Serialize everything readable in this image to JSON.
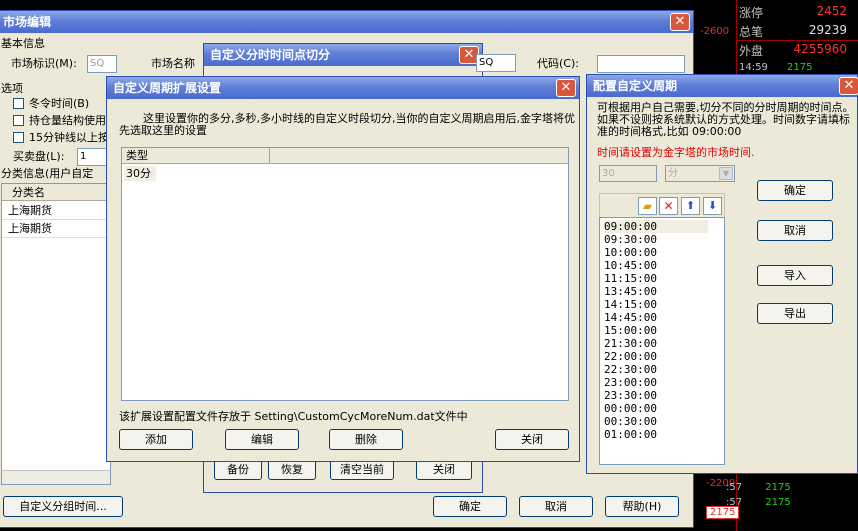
{
  "right_panel": {
    "red_value": "-2600",
    "rows": [
      {
        "label": "涨停",
        "value": "2452"
      },
      {
        "label": "总笔",
        "value": "29239"
      },
      {
        "label": "外盘",
        "value": "4255960"
      }
    ],
    "tick": {
      "time": "14:59",
      "price": "2175"
    },
    "bottom": {
      "red_value": "-2200",
      "rows": [
        {
          "time": ":57",
          "price": "2175"
        },
        {
          "time": ":57",
          "price": "2175"
        }
      ],
      "arrow_price": "2175"
    }
  },
  "market_edit": {
    "title": "市场编辑",
    "basic_info": "基本信息",
    "market_id_label": "市场标识(M):",
    "market_id_value": "SQ",
    "market_name_label": "市场名称",
    "code_label": "代码(C):",
    "options_label": "选项",
    "options": [
      {
        "label": "冬令时间(B)"
      },
      {
        "label": "持仓量结构使用"
      },
      {
        "label": "15分钟线以上按"
      }
    ],
    "buy_sell_label": "买卖盘(L):",
    "buy_sell_value": "1",
    "category_info": "分类信息(用户自定",
    "table_header": "分类名",
    "table_rows": [
      "上海期货",
      "上海期货"
    ],
    "custom_group_button": "自定义分组时间...",
    "ok": "确定",
    "cancel": "取消",
    "help": "帮助(H)"
  },
  "split_win": {
    "title": "自定义分时时间点切分",
    "sq_value": "SQ",
    "buttons": {
      "backup": "备份",
      "restore": "恢复",
      "clear": "清空当前",
      "close": "关闭"
    }
  },
  "ext_win": {
    "title": "自定义周期扩展设置",
    "description": "这里设置你的多分,多秒,多小时线的自定义时段切分,当你的自定义周期启用后,金字塔将优先选取这里的设置",
    "column": "类型",
    "rows": [
      "30分"
    ],
    "footer_note": "该扩展设置配置文件存放于 Setting\\CustomCycMoreNum.dat文件中",
    "buttons": {
      "add": "添加",
      "edit": "编辑",
      "delete": "删除",
      "close": "关闭"
    }
  },
  "config_win": {
    "title": "配置自定义周期",
    "description": "可根据用户自己需要,切分不同的分时周期的时间点。如果不设则按系统默认的方式处理。时间数字请填标准的时间格式,比如 09:00:00",
    "warning": "时间请设置为金字塔的市场时间.",
    "warning_color": "#e00000",
    "period_value": "30",
    "unit_value": "分",
    "times": [
      "09:00:00",
      "09:30:00",
      "10:00:00",
      "10:45:00",
      "11:15:00",
      "13:45:00",
      "14:15:00",
      "14:45:00",
      "15:00:00",
      "21:30:00",
      "22:00:00",
      "22:30:00",
      "23:00:00",
      "23:30:00",
      "00:00:00",
      "00:30:00",
      "01:00:00"
    ],
    "buttons": {
      "ok": "确定",
      "cancel": "取消",
      "import": "导入",
      "export": "导出"
    }
  }
}
